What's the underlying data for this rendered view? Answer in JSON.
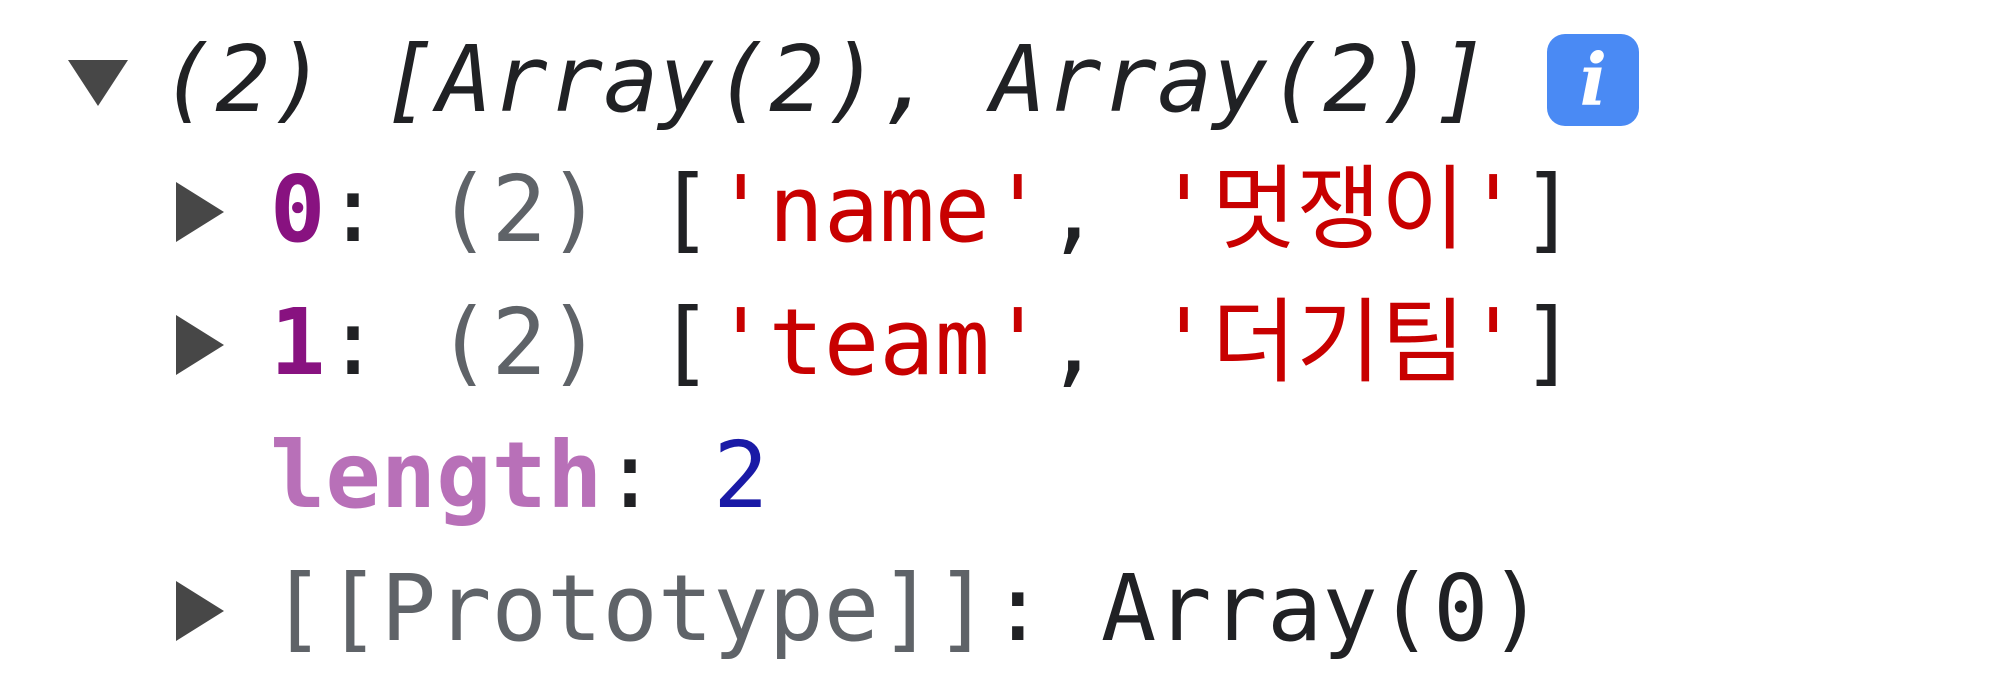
{
  "console": {
    "header": {
      "summary": "(2) [Array(2), Array(2)]",
      "info_icon_text": "i"
    },
    "entries": [
      {
        "key": "0",
        "separator": ": ",
        "count": "(2)",
        "open": " [",
        "item1": "'name'",
        "comma": ", ",
        "item2": "'멋쟁이'",
        "close": "]"
      },
      {
        "key": "1",
        "separator": ": ",
        "count": "(2)",
        "open": " [",
        "item1": "'team'",
        "comma": ", ",
        "item2": "'더기팀'",
        "close": "]"
      }
    ],
    "length": {
      "key": "length",
      "separator": ": ",
      "value": "2"
    },
    "prototype": {
      "key": "[[Prototype]]",
      "separator": ": ",
      "value": "Array(0)"
    }
  }
}
